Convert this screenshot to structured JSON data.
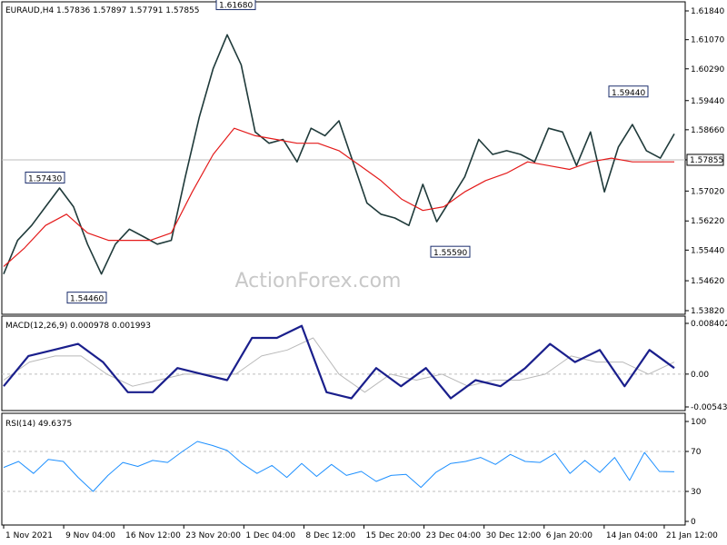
{
  "colors": {
    "price": "#1f3a3a",
    "ma": "#e41b1b",
    "macd_main": "#1a1f8c",
    "macd_signal": "#b9b9b9",
    "rsi": "#1e90ff",
    "level_line": "#bdbdbd",
    "watermark": "#c8c8c8"
  },
  "watermark": "ActionForex.com",
  "chart_data": [
    {
      "type": "line",
      "panel": "price",
      "header": "EURAUD,H4  1.57836 1.57897 1.57791 1.57855",
      "xlabel": "",
      "ylabel": "",
      "ylim": [
        1.5382,
        1.6184
      ],
      "yticks": [
        "1.61840",
        "1.61070",
        "1.60290",
        "1.59440",
        "1.58660",
        "1.57855",
        "1.57020",
        "1.56220",
        "1.55440",
        "1.54620",
        "1.53820"
      ],
      "ytick_values": [
        1.6184,
        1.6107,
        1.6029,
        1.5944,
        1.5866,
        1.57855,
        1.5702,
        1.5622,
        1.5544,
        1.5462,
        1.5382
      ],
      "current_price_label": "1.57855",
      "current_price_value": 1.57855,
      "categories": [
        "1 Nov 2021",
        "9 Nov 04:00",
        "16 Nov 12:00",
        "23 Nov 20:00",
        "1 Dec 04:00",
        "8 Dec 12:00",
        "15 Dec 20:00",
        "23 Dec 04:00",
        "30 Dec 12:00",
        "6 Jan 20:00",
        "14 Jan 04:00",
        "21 Jan 12:00"
      ],
      "series": [
        {
          "values": [
            1.548,
            1.557,
            1.561,
            1.566,
            1.571,
            1.566,
            1.556,
            1.548,
            1.556,
            1.56,
            1.558,
            1.556,
            1.557,
            1.574,
            1.59,
            1.603,
            1.612,
            1.604,
            1.586,
            1.583,
            1.584,
            1.578,
            1.587,
            1.585,
            1.589,
            1.578,
            1.567,
            1.564,
            1.563,
            1.561,
            1.572,
            1.562,
            1.568,
            1.574,
            1.584,
            1.58,
            1.581,
            1.58,
            1.578,
            1.587,
            1.586,
            1.577,
            1.586,
            1.57,
            1.582,
            1.588,
            1.581,
            1.579,
            1.5855
          ]
        },
        {
          "values": [
            1.55,
            1.555,
            1.561,
            1.564,
            1.559,
            1.557,
            1.557,
            1.557,
            1.559,
            1.57,
            1.58,
            1.587,
            1.585,
            1.584,
            1.583,
            1.583,
            1.581,
            1.577,
            1.573,
            1.568,
            1.565,
            1.566,
            1.57,
            1.573,
            1.575,
            1.578,
            1.577,
            1.576,
            1.578,
            1.579,
            1.578,
            1.578,
            1.578
          ]
        }
      ],
      "annotations": [
        {
          "label": "1.61680",
          "value": 1.6168
        },
        {
          "label": "1.59440",
          "value": 1.5944
        },
        {
          "label": "1.57430",
          "value": 1.5743
        },
        {
          "label": "1.55590",
          "value": 1.5559
        },
        {
          "label": "1.54460",
          "value": 1.5446
        }
      ]
    },
    {
      "type": "line",
      "panel": "macd",
      "header": "MACD(12,26,9)  0.000978  0.001993",
      "ylim": [
        -0.005436,
        0.008402
      ],
      "yticks": [
        "0.008402",
        "0.00",
        "-0.005436"
      ],
      "ytick_values": [
        0.008402,
        0.0,
        -0.005436
      ],
      "series": [
        {
          "values": [
            -0.002,
            0.003,
            0.004,
            0.005,
            0.002,
            -0.003,
            -0.003,
            0.001,
            0.0,
            -0.001,
            0.006,
            0.006,
            0.008,
            -0.003,
            -0.004,
            0.001,
            -0.002,
            0.001,
            -0.004,
            -0.001,
            -0.002,
            0.001,
            0.005,
            0.002,
            0.004,
            -0.002,
            0.004,
            0.001
          ]
        },
        {
          "values": [
            -0.001,
            0.002,
            0.003,
            0.003,
            0.0,
            -0.002,
            -0.001,
            0.0,
            0.0,
            0.0,
            0.003,
            0.004,
            0.006,
            0.0,
            -0.003,
            0.0,
            -0.001,
            0.0,
            -0.002,
            -0.001,
            -0.001,
            0.0,
            0.003,
            0.002,
            0.002,
            0.0,
            0.002
          ]
        }
      ]
    },
    {
      "type": "line",
      "panel": "rsi",
      "header": "RSI(14)  49.6375",
      "ylim": [
        0,
        100
      ],
      "yticks": [
        "100",
        "70",
        "30",
        "0"
      ],
      "ytick_values": [
        100,
        70,
        30,
        0
      ],
      "levels": [
        70,
        30
      ],
      "series": [
        {
          "values": [
            54,
            60,
            48,
            62,
            60,
            44,
            30,
            46,
            59,
            55,
            61,
            59,
            70,
            80,
            76,
            71,
            58,
            48,
            56,
            44,
            58,
            45,
            57,
            46,
            50,
            40,
            46,
            47,
            34,
            49,
            58,
            60,
            64,
            57,
            67,
            60,
            59,
            68,
            48,
            61,
            49,
            64,
            41,
            69,
            50,
            49.6
          ]
        }
      ]
    }
  ]
}
